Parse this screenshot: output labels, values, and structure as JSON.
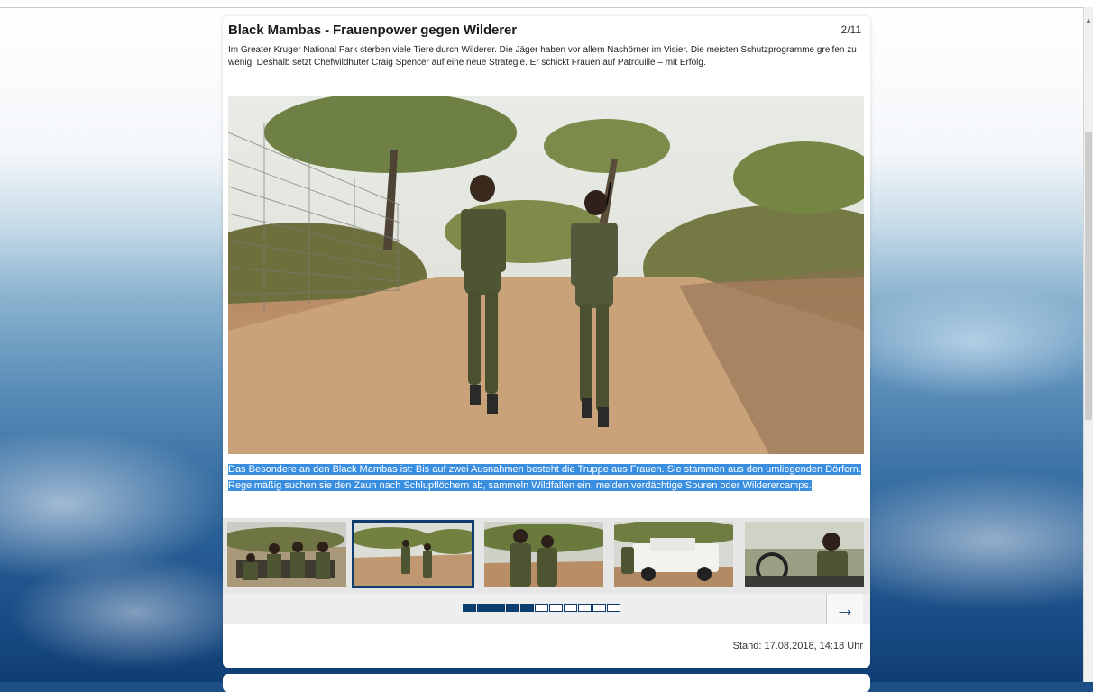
{
  "article": {
    "title": "Black Mambas - Frauenpower gegen Wilderer",
    "counter": "2/11",
    "lead": "Im Greater Kruger National Park sterben viele Tiere durch Wilderer. Die Jäger haben vor allem Nashörner im Visier. Die meisten Schutzprogramme greifen zu wenig. Deshalb setzt Chefwildhüter Craig Spencer auf eine neue Strategie. Er schickt Frauen auf Patrouille – mit Erfolg.",
    "caption": "Das Besondere an den Black Mambas ist: Bis auf zwei Ausnahmen besteht die Truppe aus Frauen. Sie stammen aus den umliegenden Dörfern. Regelmäßig suchen sie den Zaun nach Schlupflöchern ab, sammeln Wildfallen ein, melden verdächtige Spuren oder Wilderercamps.",
    "stand": "Stand: 17.08.2018, 14:18 Uhr"
  },
  "gallery": {
    "active_index": 1,
    "thumbnails": [
      "rangers-in-vehicle",
      "two-rangers-walking",
      "rangers-closeup",
      "white-land-rover",
      "ranger-driving"
    ],
    "total_slides": 11,
    "progress_filled": 5
  },
  "icons": {
    "next": "→",
    "scroll_up": "▲"
  },
  "colors": {
    "accent": "#0e3e6d",
    "selection": "#3a8ee0"
  }
}
